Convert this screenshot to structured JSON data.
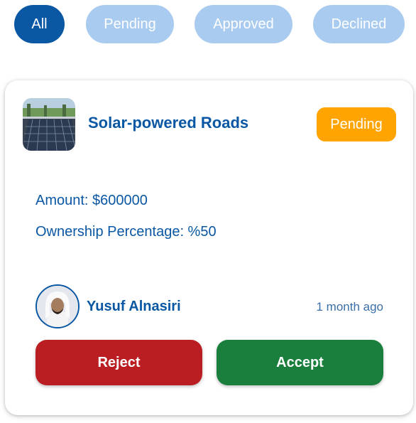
{
  "filters": [
    {
      "label": "All",
      "active": true
    },
    {
      "label": "Pending",
      "active": false
    },
    {
      "label": "Approved",
      "active": false
    },
    {
      "label": "Declined",
      "active": false
    }
  ],
  "colors": {
    "primary": "#0a57a3",
    "chip_inactive": "#a9cbef",
    "pending": "#ffa400",
    "reject": "#bb1e22",
    "accept": "#1a7f3c"
  },
  "card": {
    "title": "Solar-powered Roads",
    "status": "Pending",
    "amount": "Amount: $600000",
    "ownership": "Ownership Percentage: %50",
    "investor": {
      "name": "Yusuf Alnasiri"
    },
    "time": "1 month ago",
    "reject_label": "Reject",
    "accept_label": "Accept",
    "thumbnail_icon": "solar-road-thumbnail",
    "avatar_icon": "user-avatar"
  }
}
